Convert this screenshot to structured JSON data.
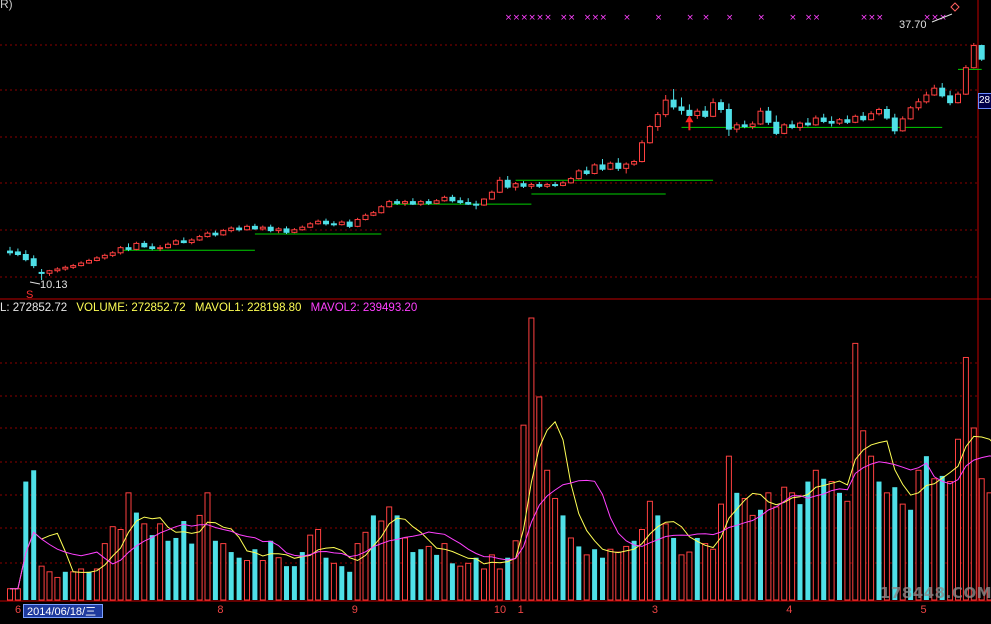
{
  "header": {
    "title_fragment": "R)"
  },
  "price_labels": {
    "low": "10.13",
    "high": "37.70"
  },
  "right_tag": "28",
  "volume_legend": {
    "vol_label": "L: 272852.72",
    "volume_label": "VOLUME: 272852.72",
    "mavol1_label": "MAVOL1: 228198.80",
    "mavol2_label": "MAVOL2: 239493.20"
  },
  "axis": {
    "date_box": "2014/06/18/三",
    "months": [
      {
        "label": "6",
        "idx": 0
      },
      {
        "label": "8",
        "idx": 26
      },
      {
        "label": "9",
        "idx": 43
      },
      {
        "label": "10",
        "idx": 61
      },
      {
        "label": "1",
        "idx": 64
      },
      {
        "label": "3",
        "idx": 81
      },
      {
        "label": "4",
        "idx": 98
      },
      {
        "label": "5",
        "idx": 115
      }
    ]
  },
  "watermark": "178448.COM",
  "colors": {
    "up": "#ff4040",
    "down": "#4fe0e8",
    "mavol1": "#ffff55",
    "mavol2": "#ff40ff",
    "support": "#00d000",
    "grid": "#8a0000",
    "marker": "#ff40ff"
  },
  "chart_data": {
    "type": "candlestick",
    "price_range": [
      8,
      42
    ],
    "candles": [
      {
        "o": 13.5,
        "h": 14.0,
        "l": 13.0,
        "c": 13.3
      },
      {
        "o": 13.4,
        "h": 13.8,
        "l": 12.9,
        "c": 13.1
      },
      {
        "o": 13.1,
        "h": 13.6,
        "l": 12.3,
        "c": 12.5
      },
      {
        "o": 12.6,
        "h": 13.0,
        "l": 11.5,
        "c": 11.8
      },
      {
        "o": 11.0,
        "h": 11.4,
        "l": 10.1,
        "c": 10.9
      },
      {
        "o": 10.9,
        "h": 11.3,
        "l": 10.6,
        "c": 11.2
      },
      {
        "o": 11.2,
        "h": 11.6,
        "l": 11.0,
        "c": 11.4
      },
      {
        "o": 11.4,
        "h": 11.8,
        "l": 11.2,
        "c": 11.6
      },
      {
        "o": 11.6,
        "h": 12.0,
        "l": 11.4,
        "c": 11.8
      },
      {
        "o": 11.8,
        "h": 12.3,
        "l": 11.7,
        "c": 12.1
      },
      {
        "o": 12.1,
        "h": 12.6,
        "l": 12.0,
        "c": 12.4
      },
      {
        "o": 12.4,
        "h": 12.9,
        "l": 12.3,
        "c": 12.7
      },
      {
        "o": 12.7,
        "h": 13.2,
        "l": 12.5,
        "c": 13.0
      },
      {
        "o": 13.0,
        "h": 13.5,
        "l": 12.8,
        "c": 13.3
      },
      {
        "o": 13.3,
        "h": 14.1,
        "l": 13.1,
        "c": 13.9
      },
      {
        "o": 13.9,
        "h": 14.4,
        "l": 13.5,
        "c": 13.7
      },
      {
        "o": 13.7,
        "h": 14.6,
        "l": 13.6,
        "c": 14.4
      },
      {
        "o": 14.4,
        "h": 14.7,
        "l": 13.9,
        "c": 14.0
      },
      {
        "o": 14.0,
        "h": 14.4,
        "l": 13.6,
        "c": 13.8
      },
      {
        "o": 13.8,
        "h": 14.2,
        "l": 13.5,
        "c": 13.9
      },
      {
        "o": 13.9,
        "h": 14.5,
        "l": 13.8,
        "c": 14.3
      },
      {
        "o": 14.3,
        "h": 14.9,
        "l": 14.2,
        "c": 14.7
      },
      {
        "o": 14.7,
        "h": 15.1,
        "l": 14.4,
        "c": 14.5
      },
      {
        "o": 14.5,
        "h": 15.0,
        "l": 14.3,
        "c": 14.8
      },
      {
        "o": 14.8,
        "h": 15.4,
        "l": 14.7,
        "c": 15.2
      },
      {
        "o": 15.2,
        "h": 15.8,
        "l": 15.1,
        "c": 15.6
      },
      {
        "o": 15.6,
        "h": 15.9,
        "l": 15.2,
        "c": 15.4
      },
      {
        "o": 15.4,
        "h": 16.1,
        "l": 15.3,
        "c": 15.9
      },
      {
        "o": 15.9,
        "h": 16.4,
        "l": 15.7,
        "c": 16.2
      },
      {
        "o": 16.2,
        "h": 16.5,
        "l": 15.8,
        "c": 16.0
      },
      {
        "o": 16.0,
        "h": 16.6,
        "l": 15.9,
        "c": 16.4
      },
      {
        "o": 16.4,
        "h": 16.7,
        "l": 16.0,
        "c": 16.1
      },
      {
        "o": 16.1,
        "h": 16.5,
        "l": 15.9,
        "c": 16.3
      },
      {
        "o": 16.3,
        "h": 16.6,
        "l": 15.7,
        "c": 15.9
      },
      {
        "o": 15.9,
        "h": 16.3,
        "l": 15.6,
        "c": 16.1
      },
      {
        "o": 16.1,
        "h": 16.4,
        "l": 15.5,
        "c": 15.7
      },
      {
        "o": 15.7,
        "h": 16.2,
        "l": 15.6,
        "c": 16.0
      },
      {
        "o": 16.0,
        "h": 16.5,
        "l": 15.9,
        "c": 16.3
      },
      {
        "o": 16.3,
        "h": 16.9,
        "l": 16.2,
        "c": 16.7
      },
      {
        "o": 16.7,
        "h": 17.2,
        "l": 16.6,
        "c": 17.0
      },
      {
        "o": 17.0,
        "h": 17.3,
        "l": 16.5,
        "c": 16.7
      },
      {
        "o": 16.7,
        "h": 17.0,
        "l": 16.4,
        "c": 16.6
      },
      {
        "o": 16.6,
        "h": 17.1,
        "l": 16.5,
        "c": 16.9
      },
      {
        "o": 16.9,
        "h": 17.2,
        "l": 16.2,
        "c": 16.4
      },
      {
        "o": 16.4,
        "h": 17.4,
        "l": 16.3,
        "c": 17.2
      },
      {
        "o": 17.2,
        "h": 17.9,
        "l": 17.1,
        "c": 17.7
      },
      {
        "o": 17.7,
        "h": 18.2,
        "l": 17.6,
        "c": 18.0
      },
      {
        "o": 18.0,
        "h": 18.9,
        "l": 17.9,
        "c": 18.7
      },
      {
        "o": 18.7,
        "h": 19.5,
        "l": 18.6,
        "c": 19.3
      },
      {
        "o": 19.3,
        "h": 19.6,
        "l": 18.9,
        "c": 19.1
      },
      {
        "o": 19.1,
        "h": 19.5,
        "l": 18.8,
        "c": 19.3
      },
      {
        "o": 19.3,
        "h": 19.7,
        "l": 18.9,
        "c": 19.0
      },
      {
        "o": 19.0,
        "h": 19.5,
        "l": 18.8,
        "c": 19.3
      },
      {
        "o": 19.3,
        "h": 19.6,
        "l": 18.9,
        "c": 19.1
      },
      {
        "o": 19.1,
        "h": 19.6,
        "l": 19.0,
        "c": 19.4
      },
      {
        "o": 19.4,
        "h": 20.0,
        "l": 19.3,
        "c": 19.8
      },
      {
        "o": 19.8,
        "h": 20.1,
        "l": 19.2,
        "c": 19.4
      },
      {
        "o": 19.4,
        "h": 19.8,
        "l": 19.0,
        "c": 19.2
      },
      {
        "o": 19.2,
        "h": 19.7,
        "l": 18.9,
        "c": 19.0
      },
      {
        "o": 19.0,
        "h": 19.4,
        "l": 18.4,
        "c": 18.9
      },
      {
        "o": 18.9,
        "h": 19.7,
        "l": 18.8,
        "c": 19.6
      },
      {
        "o": 19.6,
        "h": 20.6,
        "l": 19.5,
        "c": 20.4
      },
      {
        "o": 20.4,
        "h": 22.2,
        "l": 20.3,
        "c": 21.8
      },
      {
        "o": 21.8,
        "h": 22.3,
        "l": 20.8,
        "c": 21.0
      },
      {
        "o": 21.0,
        "h": 21.6,
        "l": 20.6,
        "c": 21.4
      },
      {
        "o": 21.4,
        "h": 21.7,
        "l": 20.9,
        "c": 21.1
      },
      {
        "o": 21.1,
        "h": 21.5,
        "l": 20.8,
        "c": 21.3
      },
      {
        "o": 21.3,
        "h": 21.6,
        "l": 20.9,
        "c": 21.1
      },
      {
        "o": 21.1,
        "h": 21.5,
        "l": 20.9,
        "c": 21.3
      },
      {
        "o": 21.3,
        "h": 21.6,
        "l": 21.0,
        "c": 21.2
      },
      {
        "o": 21.2,
        "h": 21.7,
        "l": 21.1,
        "c": 21.5
      },
      {
        "o": 21.5,
        "h": 22.2,
        "l": 21.4,
        "c": 22.0
      },
      {
        "o": 22.0,
        "h": 23.1,
        "l": 21.9,
        "c": 22.9
      },
      {
        "o": 22.9,
        "h": 23.4,
        "l": 22.4,
        "c": 22.6
      },
      {
        "o": 22.6,
        "h": 23.8,
        "l": 22.5,
        "c": 23.6
      },
      {
        "o": 23.6,
        "h": 24.3,
        "l": 22.9,
        "c": 23.1
      },
      {
        "o": 23.1,
        "h": 24.0,
        "l": 23.0,
        "c": 23.8
      },
      {
        "o": 23.8,
        "h": 24.4,
        "l": 22.9,
        "c": 23.2
      },
      {
        "o": 23.2,
        "h": 23.9,
        "l": 22.6,
        "c": 23.7
      },
      {
        "o": 23.7,
        "h": 24.2,
        "l": 23.5,
        "c": 24.0
      },
      {
        "o": 24.0,
        "h": 26.5,
        "l": 23.9,
        "c": 26.2
      },
      {
        "o": 26.2,
        "h": 28.3,
        "l": 26.1,
        "c": 28.1
      },
      {
        "o": 28.1,
        "h": 29.8,
        "l": 27.6,
        "c": 29.5
      },
      {
        "o": 29.5,
        "h": 31.8,
        "l": 29.2,
        "c": 31.2
      },
      {
        "o": 31.2,
        "h": 32.5,
        "l": 30.1,
        "c": 30.4
      },
      {
        "o": 30.4,
        "h": 31.5,
        "l": 29.5,
        "c": 30.0
      },
      {
        "o": 30.0,
        "h": 30.7,
        "l": 29.2,
        "c": 29.4
      },
      {
        "o": 29.4,
        "h": 30.2,
        "l": 29.0,
        "c": 29.9
      },
      {
        "o": 29.9,
        "h": 30.5,
        "l": 29.1,
        "c": 29.3
      },
      {
        "o": 29.3,
        "h": 31.4,
        "l": 29.2,
        "c": 30.9
      },
      {
        "o": 30.9,
        "h": 31.3,
        "l": 29.7,
        "c": 30.1
      },
      {
        "o": 30.1,
        "h": 30.8,
        "l": 27.0,
        "c": 27.8
      },
      {
        "o": 27.8,
        "h": 28.6,
        "l": 27.4,
        "c": 28.3
      },
      {
        "o": 28.3,
        "h": 28.8,
        "l": 27.9,
        "c": 28.1
      },
      {
        "o": 28.1,
        "h": 28.7,
        "l": 27.8,
        "c": 28.4
      },
      {
        "o": 28.4,
        "h": 30.3,
        "l": 28.3,
        "c": 29.9
      },
      {
        "o": 29.9,
        "h": 30.4,
        "l": 28.3,
        "c": 28.6
      },
      {
        "o": 28.6,
        "h": 29.4,
        "l": 27.1,
        "c": 27.3
      },
      {
        "o": 27.3,
        "h": 28.5,
        "l": 27.2,
        "c": 28.3
      },
      {
        "o": 28.3,
        "h": 28.8,
        "l": 27.8,
        "c": 28.0
      },
      {
        "o": 28.0,
        "h": 28.7,
        "l": 27.6,
        "c": 28.5
      },
      {
        "o": 28.5,
        "h": 29.1,
        "l": 28.1,
        "c": 28.3
      },
      {
        "o": 28.3,
        "h": 29.4,
        "l": 28.2,
        "c": 29.1
      },
      {
        "o": 29.1,
        "h": 29.6,
        "l": 28.5,
        "c": 28.7
      },
      {
        "o": 28.7,
        "h": 29.3,
        "l": 28.1,
        "c": 28.5
      },
      {
        "o": 28.5,
        "h": 29.1,
        "l": 28.3,
        "c": 28.9
      },
      {
        "o": 28.9,
        "h": 29.4,
        "l": 28.4,
        "c": 28.6
      },
      {
        "o": 28.6,
        "h": 29.5,
        "l": 28.5,
        "c": 29.3
      },
      {
        "o": 29.3,
        "h": 29.8,
        "l": 28.7,
        "c": 28.9
      },
      {
        "o": 28.9,
        "h": 29.9,
        "l": 28.8,
        "c": 29.6
      },
      {
        "o": 29.6,
        "h": 30.3,
        "l": 29.4,
        "c": 30.1
      },
      {
        "o": 30.1,
        "h": 30.5,
        "l": 28.9,
        "c": 29.1
      },
      {
        "o": 29.1,
        "h": 29.6,
        "l": 27.2,
        "c": 27.6
      },
      {
        "o": 27.6,
        "h": 29.3,
        "l": 27.5,
        "c": 29.0
      },
      {
        "o": 29.0,
        "h": 30.5,
        "l": 28.9,
        "c": 30.3
      },
      {
        "o": 30.3,
        "h": 31.4,
        "l": 30.0,
        "c": 31.0
      },
      {
        "o": 31.0,
        "h": 32.2,
        "l": 30.8,
        "c": 31.8
      },
      {
        "o": 31.8,
        "h": 33.0,
        "l": 31.7,
        "c": 32.6
      },
      {
        "o": 32.6,
        "h": 33.2,
        "l": 31.5,
        "c": 31.7
      },
      {
        "o": 31.7,
        "h": 32.3,
        "l": 30.6,
        "c": 30.9
      },
      {
        "o": 30.9,
        "h": 32.2,
        "l": 30.8,
        "c": 31.9
      },
      {
        "o": 31.9,
        "h": 35.3,
        "l": 31.8,
        "c": 35.0
      },
      {
        "o": 35.0,
        "h": 37.9,
        "l": 34.9,
        "c": 37.6
      },
      {
        "o": 37.6,
        "h": 37.7,
        "l": 35.8,
        "c": 36.0
      }
    ],
    "volume": [
      {
        "v": 4,
        "up": true
      },
      {
        "v": 4,
        "up": true
      },
      {
        "v": 42,
        "up": false
      },
      {
        "v": 46,
        "up": false
      },
      {
        "v": 12,
        "up": true
      },
      {
        "v": 10,
        "up": true
      },
      {
        "v": 8,
        "up": true
      },
      {
        "v": 10,
        "up": false
      },
      {
        "v": 10,
        "up": true
      },
      {
        "v": 11,
        "up": true
      },
      {
        "v": 10,
        "up": false
      },
      {
        "v": 11,
        "up": true
      },
      {
        "v": 20,
        "up": true
      },
      {
        "v": 26,
        "up": true
      },
      {
        "v": 25,
        "up": true
      },
      {
        "v": 38,
        "up": true
      },
      {
        "v": 31,
        "up": false
      },
      {
        "v": 27,
        "up": true
      },
      {
        "v": 23,
        "up": false
      },
      {
        "v": 27,
        "up": true
      },
      {
        "v": 21,
        "up": false
      },
      {
        "v": 22,
        "up": false
      },
      {
        "v": 28,
        "up": false
      },
      {
        "v": 20,
        "up": false
      },
      {
        "v": 30,
        "up": true
      },
      {
        "v": 38,
        "up": true
      },
      {
        "v": 21,
        "up": false
      },
      {
        "v": 20,
        "up": true
      },
      {
        "v": 17,
        "up": false
      },
      {
        "v": 15,
        "up": false
      },
      {
        "v": 14,
        "up": true
      },
      {
        "v": 18,
        "up": false
      },
      {
        "v": 14,
        "up": true
      },
      {
        "v": 21,
        "up": false
      },
      {
        "v": 15,
        "up": true
      },
      {
        "v": 12,
        "up": false
      },
      {
        "v": 12,
        "up": false
      },
      {
        "v": 17,
        "up": false
      },
      {
        "v": 23,
        "up": true
      },
      {
        "v": 25,
        "up": true
      },
      {
        "v": 15,
        "up": false
      },
      {
        "v": 13,
        "up": true
      },
      {
        "v": 12,
        "up": false
      },
      {
        "v": 10,
        "up": false
      },
      {
        "v": 20,
        "up": true
      },
      {
        "v": 24,
        "up": true
      },
      {
        "v": 30,
        "up": false
      },
      {
        "v": 28,
        "up": true
      },
      {
        "v": 33,
        "up": true
      },
      {
        "v": 30,
        "up": false
      },
      {
        "v": 22,
        "up": true
      },
      {
        "v": 17,
        "up": false
      },
      {
        "v": 18,
        "up": false
      },
      {
        "v": 19,
        "up": true
      },
      {
        "v": 16,
        "up": false
      },
      {
        "v": 20,
        "up": true
      },
      {
        "v": 13,
        "up": false
      },
      {
        "v": 12,
        "up": true
      },
      {
        "v": 13,
        "up": true
      },
      {
        "v": 15,
        "up": false
      },
      {
        "v": 11,
        "up": true
      },
      {
        "v": 16,
        "up": true
      },
      {
        "v": 11,
        "up": true
      },
      {
        "v": 15,
        "up": false
      },
      {
        "v": 21,
        "up": true
      },
      {
        "v": 62,
        "up": true
      },
      {
        "v": 100,
        "up": true
      },
      {
        "v": 72,
        "up": true
      },
      {
        "v": 46,
        "up": true
      },
      {
        "v": 36,
        "up": true
      },
      {
        "v": 30,
        "up": false
      },
      {
        "v": 22,
        "up": true
      },
      {
        "v": 19,
        "up": false
      },
      {
        "v": 16,
        "up": true
      },
      {
        "v": 18,
        "up": false
      },
      {
        "v": 15,
        "up": false
      },
      {
        "v": 18,
        "up": true
      },
      {
        "v": 17,
        "up": true
      },
      {
        "v": 19,
        "up": true
      },
      {
        "v": 21,
        "up": false
      },
      {
        "v": 25,
        "up": true
      },
      {
        "v": 35,
        "up": true
      },
      {
        "v": 30,
        "up": false
      },
      {
        "v": 27,
        "up": true
      },
      {
        "v": 22,
        "up": false
      },
      {
        "v": 16,
        "up": true
      },
      {
        "v": 17,
        "up": true
      },
      {
        "v": 22,
        "up": false
      },
      {
        "v": 20,
        "up": true
      },
      {
        "v": 18,
        "up": true
      },
      {
        "v": 34,
        "up": true
      },
      {
        "v": 51,
        "up": true
      },
      {
        "v": 38,
        "up": false
      },
      {
        "v": 36,
        "up": true
      },
      {
        "v": 30,
        "up": true
      },
      {
        "v": 32,
        "up": false
      },
      {
        "v": 38,
        "up": true
      },
      {
        "v": 33,
        "up": true
      },
      {
        "v": 40,
        "up": true
      },
      {
        "v": 38,
        "up": true
      },
      {
        "v": 34,
        "up": false
      },
      {
        "v": 42,
        "up": false
      },
      {
        "v": 46,
        "up": true
      },
      {
        "v": 43,
        "up": false
      },
      {
        "v": 42,
        "up": true
      },
      {
        "v": 38,
        "up": false
      },
      {
        "v": 35,
        "up": true
      },
      {
        "v": 91,
        "up": true
      },
      {
        "v": 60,
        "up": true
      },
      {
        "v": 51,
        "up": true
      },
      {
        "v": 42,
        "up": false
      },
      {
        "v": 38,
        "up": true
      },
      {
        "v": 40,
        "up": false
      },
      {
        "v": 34,
        "up": true
      },
      {
        "v": 32,
        "up": false
      },
      {
        "v": 46,
        "up": true
      },
      {
        "v": 51,
        "up": false
      },
      {
        "v": 43,
        "up": true
      },
      {
        "v": 44,
        "up": false
      },
      {
        "v": 42,
        "up": true
      },
      {
        "v": 57,
        "up": true
      },
      {
        "v": 86,
        "up": true
      },
      {
        "v": 61,
        "up": true
      },
      {
        "v": 43,
        "up": true
      },
      {
        "v": 38,
        "up": true
      },
      {
        "v": 42,
        "up": true
      },
      {
        "v": 59,
        "up": true
      },
      {
        "v": 70,
        "up": true
      }
    ],
    "volume_range": [
      0,
      100
    ]
  }
}
